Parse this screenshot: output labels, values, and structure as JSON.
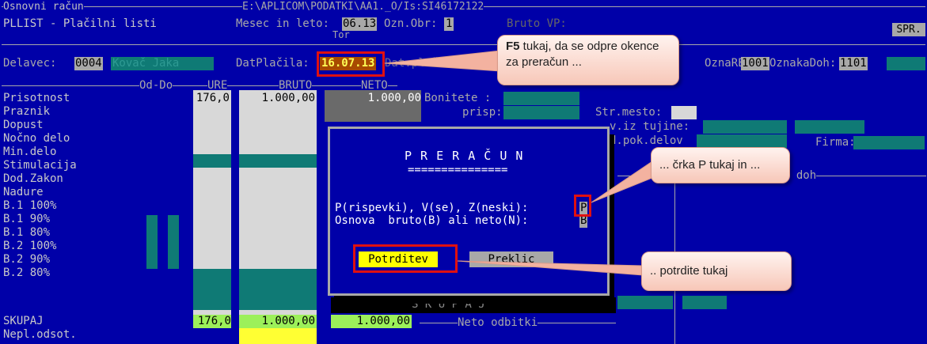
{
  "window": {
    "title_left": "Osnovni račun",
    "path": "E:\\APLICOM\\PODATKI\\AA1._O/Is:SI46172122"
  },
  "header": {
    "program": "PLLIST - Plačilni listi",
    "mesec_label": "Mesec in leto:",
    "mesec_value": "06.13",
    "ozn_obr_label": "Ozn.Obr:",
    "ozn_obr_value": "1",
    "bruto_label": "Bruto VP:",
    "spr": "SPR.",
    "tor": "Tor"
  },
  "row2": {
    "delavec_label": "Delavec:",
    "delavec_code": "0004",
    "delavec_name": "Kovač Jaka",
    "datplacila_label": "DatPlačila:",
    "datplacila_value": "16.07.13",
    "dat_label": "Dat.plačila sta",
    "oznrek_label": "OznaREK:",
    "oznrek_value": "1001",
    "oznakadoh_label": "OznakaDoh:",
    "oznakadoh_value": "1101"
  },
  "columns": {
    "oddo": "Od-Do",
    "ure": "URE",
    "bruto": "BRUTO",
    "neto": "NETO"
  },
  "rows": [
    {
      "label": "Prisotnost",
      "ure": "176,0",
      "bruto": "1.000,00",
      "neto": "1.000,00"
    },
    {
      "label": "Praznik"
    },
    {
      "label": "Dopust"
    },
    {
      "label": "Nočno delo"
    },
    {
      "label": "Min.delo"
    },
    {
      "label": "Stimulacija"
    },
    {
      "label": "Dod.Zakon"
    },
    {
      "label": "Nadure"
    },
    {
      "label": "B.1 100%"
    },
    {
      "label": "B.1 90%"
    },
    {
      "label": "B.1 80%"
    },
    {
      "label": "B.2 100%"
    },
    {
      "label": "B.2 90%"
    },
    {
      "label": "B.2 80%"
    },
    {
      "label": "SKUPAJ",
      "ure": "176,0",
      "bruto": "1.000,00",
      "neto": "1.000,00"
    },
    {
      "label": "Nepl.odsot."
    }
  ],
  "right_panel": {
    "bonitete": "Bonitete :",
    "prisp": "prisp:",
    "strmesto": "Str.mesto:",
    "tujine": "v.iz tujine:",
    "pokdel": "d.pok.delov",
    "firma": "Firma:",
    "prisp_iz_doh": "Prisp.iz doh",
    "skupaj": "S K U P A J",
    "neto_odbitki": "Neto odbitki"
  },
  "dialog": {
    "title": "P R E R A Č U N",
    "underline": "===============",
    "q1": "P(rispevki), V(se), Z(neski):",
    "q1_value": "P",
    "q2": "Osnova  bruto(B) ali neto(N):",
    "q2_value": "B",
    "confirm": "Potrditev",
    "cancel": "Preklic"
  },
  "callouts": {
    "c1_key": "F5",
    "c1_text": " tukaj, da se odpre okence za preračun ...",
    "c2": "... črka P tukaj in ...",
    "c3": ".. potrdite tukaj"
  },
  "colors": {
    "screen_bg": "#0000a8",
    "highlight_red": "#e01010",
    "confirm_bg": "#ffff00",
    "teal": "#0f7a75"
  }
}
